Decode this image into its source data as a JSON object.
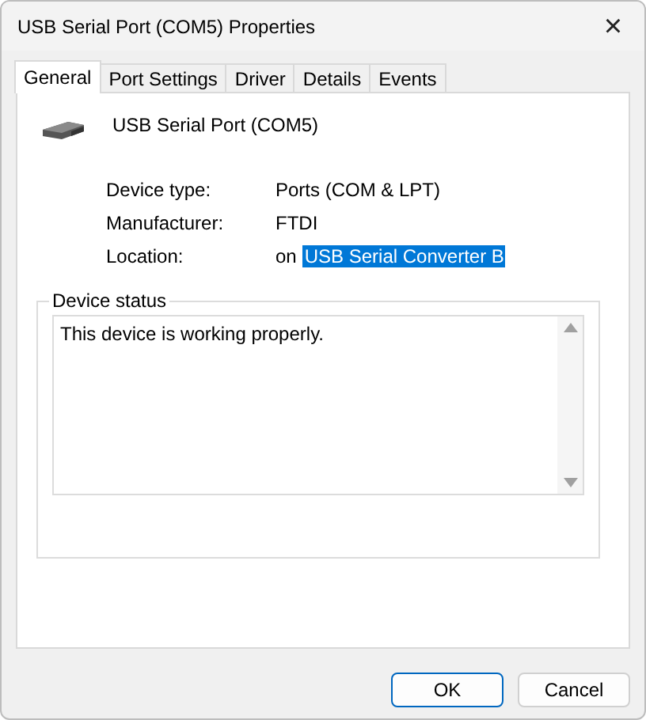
{
  "window": {
    "title": "USB Serial Port (COM5) Properties",
    "close": "×"
  },
  "tabs": [
    {
      "label": "General",
      "selected": true
    },
    {
      "label": "Port Settings",
      "selected": false
    },
    {
      "label": "Driver",
      "selected": false
    },
    {
      "label": "Details",
      "selected": false
    },
    {
      "label": "Events",
      "selected": false
    }
  ],
  "device": {
    "name": "USB Serial Port (COM5)"
  },
  "properties": [
    {
      "label": "Device type:",
      "value": "Ports (COM & LPT)"
    },
    {
      "label": "Manufacturer:",
      "value": "FTDI"
    },
    {
      "label": "Location:",
      "prefix": "on",
      "value": "USB Serial Converter B",
      "highlighted": true
    }
  ],
  "device_status": {
    "title": "Device status",
    "text": "This device is working properly."
  },
  "buttons": [
    {
      "label": "OK",
      "default": true
    },
    {
      "label": "Cancel",
      "default": false
    }
  ]
}
